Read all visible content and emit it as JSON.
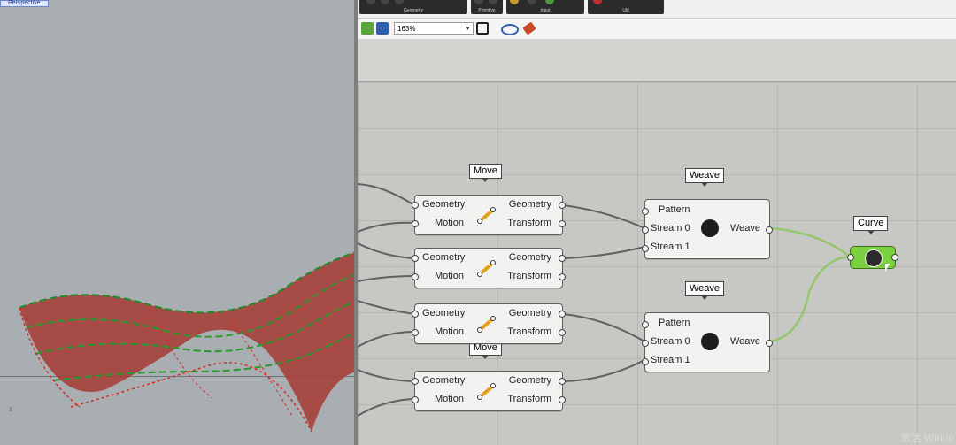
{
  "viewport": {
    "tab_label": "Perspective",
    "axis_label": "z"
  },
  "tabs": [
    "Geometry",
    "Primitive",
    "Input",
    "Util"
  ],
  "toolbar": {
    "zoom": "163%"
  },
  "components": {
    "move_label": "Move",
    "move_inputs": [
      "Geometry",
      "Motion"
    ],
    "move_outputs": [
      "Geometry",
      "Transform"
    ],
    "weave_label": "Weave",
    "weave_inputs": [
      "Pattern",
      "Stream 0",
      "Stream 1"
    ],
    "weave_output": "Weave",
    "curve_label": "Curve"
  },
  "colors": {
    "wire": "#606060",
    "selected_wire": "#94c76c",
    "curve_fill": "#7bd040"
  },
  "watermark": "激活 Windo"
}
